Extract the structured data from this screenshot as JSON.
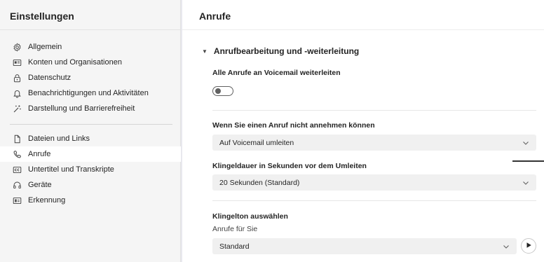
{
  "sidebar": {
    "title": "Einstellungen",
    "items": [
      {
        "label": "Allgemein",
        "icon": "gear-icon"
      },
      {
        "label": "Konten und Organisationen",
        "icon": "id-card-icon"
      },
      {
        "label": "Datenschutz",
        "icon": "lock-icon"
      },
      {
        "label": "Benachrichtigungen und Aktivitäten",
        "icon": "bell-icon"
      },
      {
        "label": "Darstellung und Barrierefreiheit",
        "icon": "magic-wand-icon"
      },
      {
        "label": "Dateien und Links",
        "icon": "file-icon"
      },
      {
        "label": "Anrufe",
        "icon": "phone-icon"
      },
      {
        "label": "Untertitel und Transkripte",
        "icon": "captions-icon"
      },
      {
        "label": "Geräte",
        "icon": "headset-icon"
      },
      {
        "label": "Erkennung",
        "icon": "recognition-icon"
      }
    ],
    "selected": "Anrufe"
  },
  "main": {
    "title": "Anrufe",
    "section_title": "Anrufbearbeitung und -weiterleitung",
    "forward_label": "Alle Anrufe an Voicemail weiterleiten",
    "forward_on": false,
    "unanswered_label": "Wenn Sie einen Anruf nicht annehmen können",
    "unanswered_value": "Auf Voicemail umleiten",
    "ring_duration_label": "Klingeldauer in Sekunden vor dem Umleiten",
    "ring_duration_value": "20 Sekunden (Standard)",
    "ringtone_label": "Klingelton auswählen",
    "ringtone_sub": "Anrufe für Sie",
    "ringtone_value": "Standard"
  },
  "colors": {
    "sidebar_bg": "#f5f5f5",
    "selected_bg": "#ffffff",
    "select_bg": "#f0f0f0"
  }
}
